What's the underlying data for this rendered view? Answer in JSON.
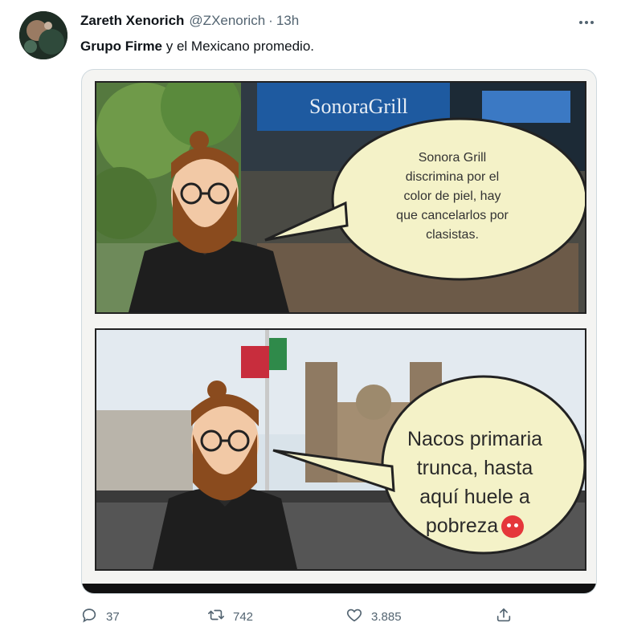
{
  "tweet": {
    "author_name": "Zareth Xenorich",
    "handle": "@ZXenorich",
    "separator": "·",
    "time": "13h",
    "more_icon": "more-horizontal-icon",
    "text_bold": "Grupo Firme",
    "text_rest": " y el Mexicano promedio."
  },
  "meme": {
    "top_sign": "SonoraGrill",
    "top_bubble": "Sonora Grill discrimina por el color de piel, hay que cancelarlos por clasistas.",
    "bottom_bubble": "Nacos primaria trunca, hasta aquí huele a pobreza",
    "emoji": "angry-face-emoji"
  },
  "actions": {
    "reply_count": "37",
    "retweet_count": "742",
    "like_count": "3.885",
    "reply_icon": "reply-icon",
    "retweet_icon": "retweet-icon",
    "like_icon": "heart-icon",
    "share_icon": "share-icon"
  },
  "colors": {
    "text_primary": "#0f1419",
    "text_secondary": "#536471",
    "border": "#cfd9de"
  }
}
